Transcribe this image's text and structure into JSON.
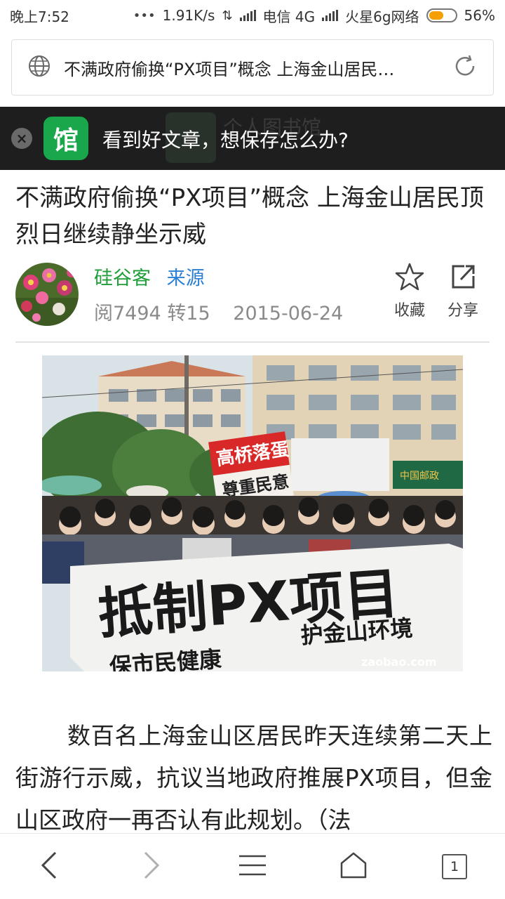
{
  "status_bar": {
    "time": "晚上7:52",
    "dots": "•••",
    "net_speed": "1.91K/s",
    "carrier1": "电信 4G",
    "carrier2": "火星6g网络",
    "battery_percent": "56%",
    "battery_level": 0.56,
    "battery_color": "#f5a000"
  },
  "address_bar": {
    "page_title": "不满政府偷换“PX项目”概念 上海金山居民…",
    "globe_icon": "globe-icon",
    "refresh_icon": "refresh-icon"
  },
  "banner": {
    "text": "看到好文章，想保存怎么办?",
    "app_icon_glyph": "馆",
    "ghost_text": "个人图书馆",
    "close_glyph": "×"
  },
  "article": {
    "title": "不满政府偷换“PX项目”概念 上海金山居民顶烈日继续静坐示威",
    "author": "硅谷客",
    "source": "来源",
    "reads": "阅7494",
    "reposts": "转15",
    "date": "2015-06-24",
    "actions": {
      "favorite": "收藏",
      "share": "分享"
    },
    "body": "数百名上海金山区居民昨天连续第二天上街游行示威，抗议当地政府推展PX项目，但金山区政府一再否认有此规划。（法"
  },
  "photo": {
    "sign_top": "高桥落蛋",
    "sign_bottom": "尊重民意",
    "banner_main": "抵制PX项目",
    "banner_sub1": "保市民健康",
    "banner_sub2": "护金山环境",
    "watermark": "zaobao.com",
    "shop_sign": "中国邮政"
  },
  "bottom_nav": {
    "tab_count": "1"
  },
  "colors": {
    "author_green": "#1f9e3a",
    "source_blue": "#2a7fd4",
    "banner_bg": "#1e1e1e",
    "app_green": "#1aa64a"
  }
}
